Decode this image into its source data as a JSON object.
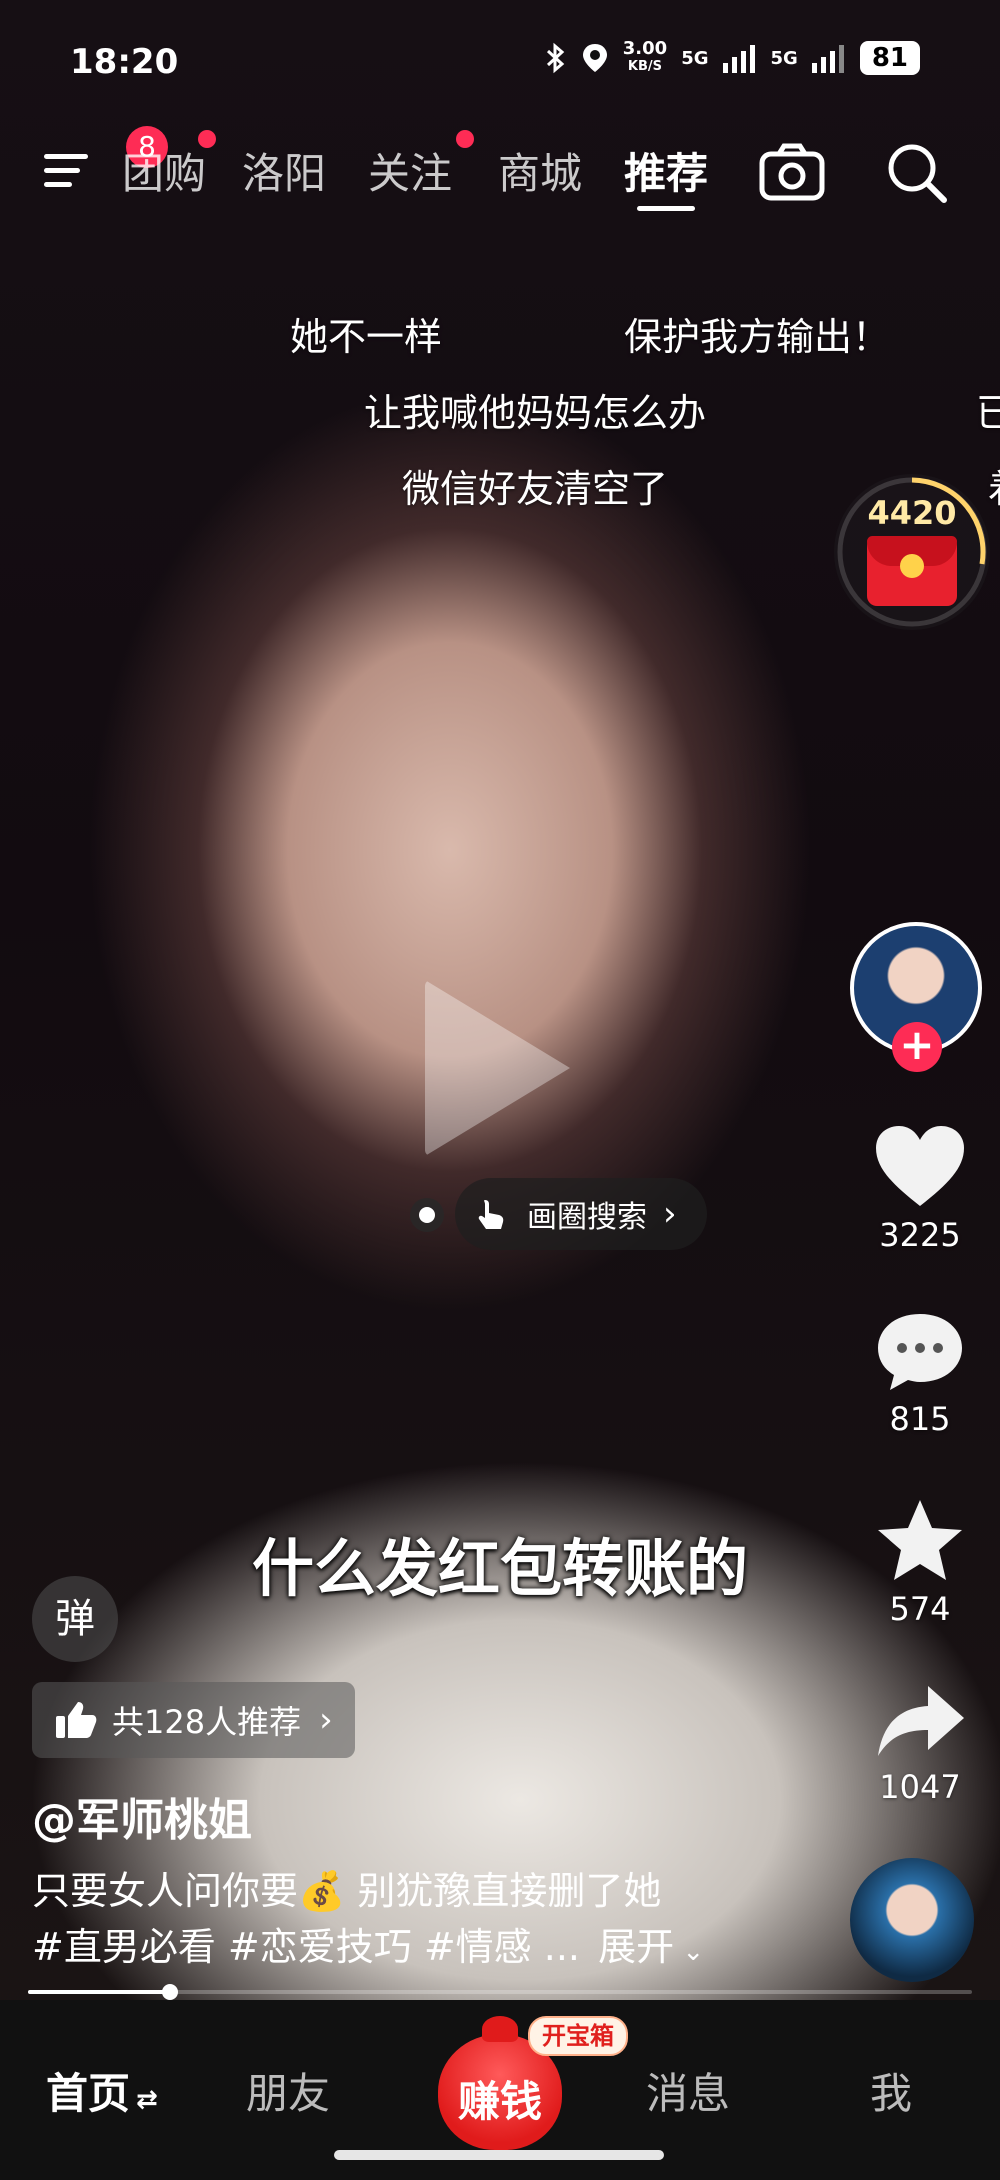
{
  "status_bar": {
    "time": "18:20",
    "net_speed_value": "3.00",
    "net_speed_unit": "KB/S",
    "signal_1": "5G",
    "signal_2": "5G",
    "battery": "81"
  },
  "top_nav": {
    "menu_badge": "8",
    "tabs": [
      {
        "label": "团购",
        "has_dot": true
      },
      {
        "label": "洛阳",
        "has_dot": false
      },
      {
        "label": "关注",
        "has_dot": true
      },
      {
        "label": "商城",
        "has_dot": false
      },
      {
        "label": "推荐",
        "has_dot": false,
        "active": true
      }
    ],
    "icons": [
      "camera-icon",
      "search-icon"
    ]
  },
  "danmu": [
    "她不一样",
    "保护我方输出！",
    "让我喊他妈妈怎么办",
    "已",
    "微信好友清空了",
    "着"
  ],
  "reward": {
    "count": "4420",
    "icon": "red-packet-icon"
  },
  "circle_search": {
    "label": "画圈搜索"
  },
  "side_actions": {
    "likes": "3225",
    "comments": "815",
    "favorites": "574",
    "shares": "1047"
  },
  "video": {
    "subtitle": "什么发红包转账的"
  },
  "info": {
    "danmu_toggle": "弹",
    "recommend": "共128人推荐",
    "author": "@军师桃姐",
    "description": "只要女人问你要💰 别犹豫直接删了她",
    "tags": "#直男必看 #恋爱技巧 #情感 ...",
    "expand": "展开",
    "progress": 0.15
  },
  "bottom_nav": {
    "home": "首页",
    "friends": "朋友",
    "earn": "赚钱",
    "earn_tag": "开宝箱",
    "messages": "消息",
    "me": "我"
  },
  "colors": {
    "accent": "#fe2c55",
    "earn_red": "#e01b1b"
  }
}
